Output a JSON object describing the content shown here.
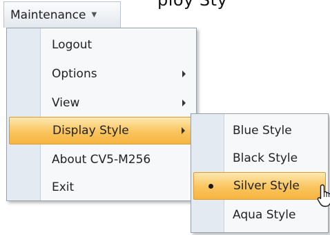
{
  "top_fragment": "ploy Sty",
  "menubar": {
    "label": "Maintenance"
  },
  "main_menu": {
    "items": [
      {
        "label": "Logout",
        "submenu": false
      },
      {
        "label": "Options",
        "submenu": true
      },
      {
        "label": "View",
        "submenu": true
      },
      {
        "label": "Display Style",
        "submenu": true,
        "highlighted": true
      },
      {
        "label": "About CV5-M256",
        "submenu": false
      },
      {
        "label": "Exit",
        "submenu": false
      }
    ]
  },
  "display_style_menu": {
    "items": [
      {
        "label": "Blue Style"
      },
      {
        "label": "Black Style"
      },
      {
        "label": "Silver Style",
        "selected": true,
        "highlighted": true
      },
      {
        "label": "Aqua Style"
      }
    ]
  },
  "colors": {
    "highlight": "#f9c45e",
    "gutter": "#e4eaf1",
    "menu_border": "#979fa8"
  }
}
